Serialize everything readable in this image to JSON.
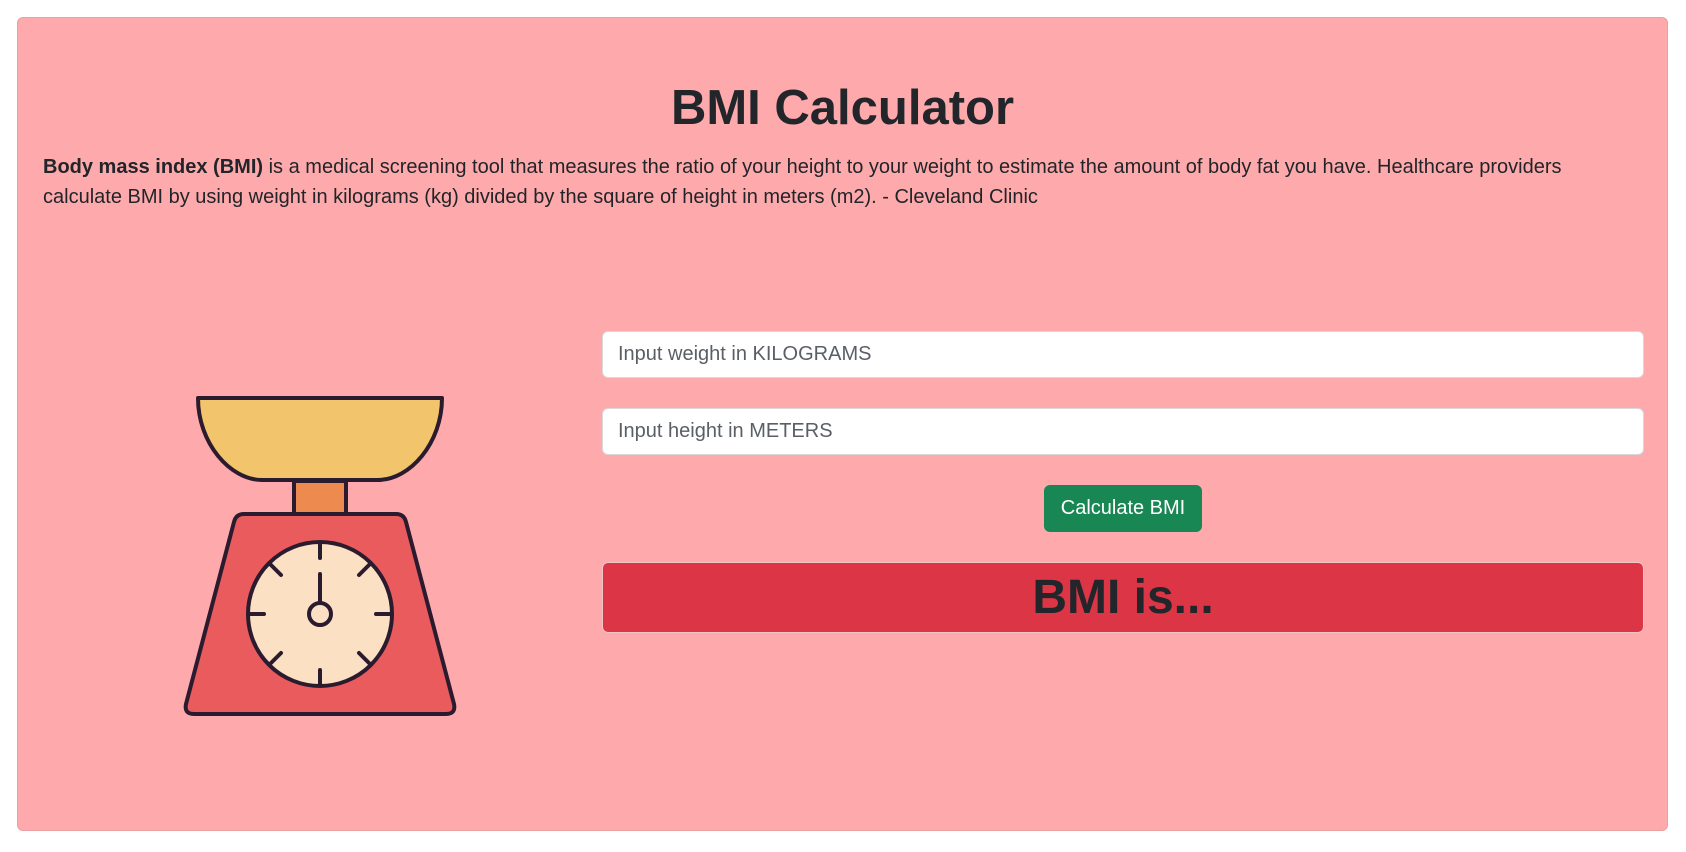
{
  "page": {
    "title": "BMI Calculator",
    "intro_bold": "Body mass index (BMI)",
    "intro_text": " is a medical screening tool that measures the ratio of your height to your weight to estimate the amount of body fat you have. Healthcare providers calculate BMI by using weight in kilograms (kg) divided by the square of height in meters (m2). - Cleveland Clinic"
  },
  "form": {
    "weight_placeholder": "Input weight in KILOGRAMS",
    "weight_value": "",
    "height_placeholder": "Input height in METERS",
    "height_value": "",
    "calculate_label": "Calculate BMI",
    "result_text": "BMI is..."
  },
  "illustration": {
    "icon": "kitchen-scale-icon"
  },
  "colors": {
    "card_background": "#fea9ab",
    "button": "#198754",
    "result_background": "#dc3545",
    "scale_bowl": "#f2c46b",
    "scale_neck": "#ec8a4f",
    "scale_body": "#e95b5c",
    "scale_dial": "#fbe0c3",
    "outline": "#2b1b2e"
  }
}
